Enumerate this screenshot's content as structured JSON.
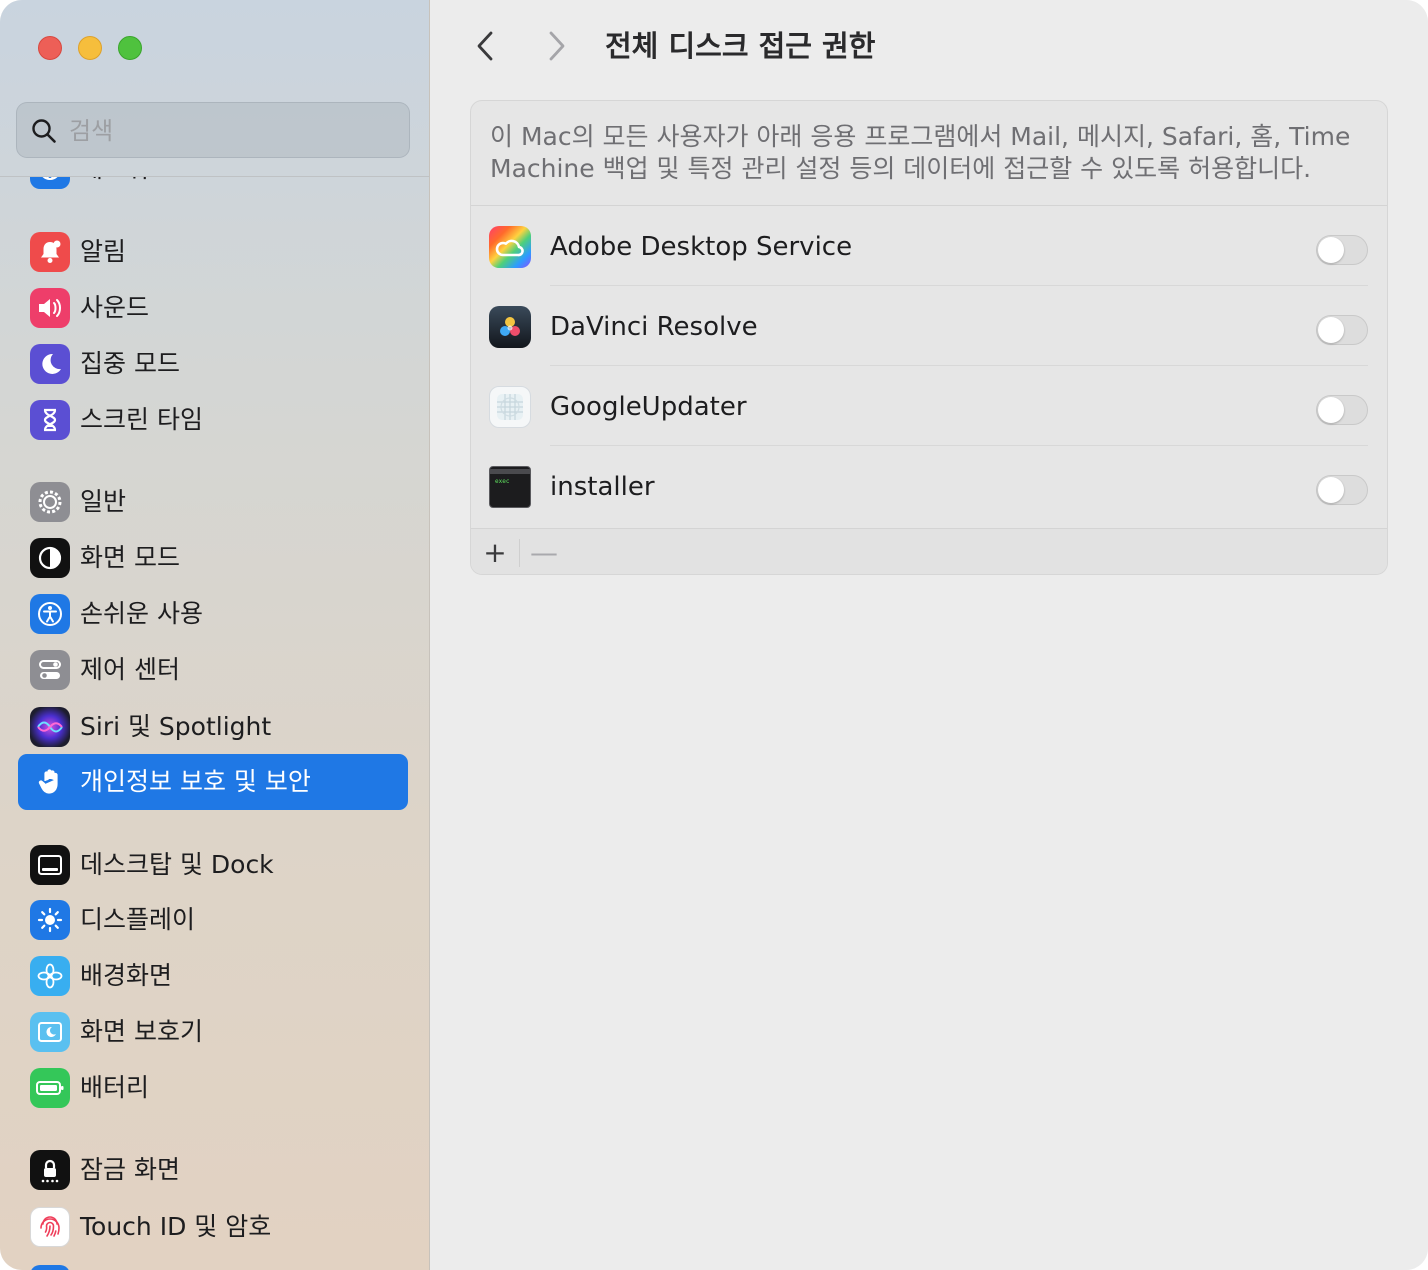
{
  "window": {
    "traffic_lights": [
      "close",
      "minimize",
      "zoom"
    ]
  },
  "search": {
    "placeholder": "검색",
    "value": ""
  },
  "sidebar": {
    "partial_top_item": {
      "label": "네트워크",
      "icon": "globe-icon",
      "color": "#1f78e5"
    },
    "groups": [
      [
        {
          "label": "알림",
          "icon": "bell-icon",
          "color": "#ef4b4b"
        },
        {
          "label": "사운드",
          "icon": "speaker-icon",
          "color": "#ee3e6a"
        },
        {
          "label": "집중 모드",
          "icon": "moon-icon",
          "color": "#5b4fd3"
        },
        {
          "label": "스크린 타임",
          "icon": "hourglass-icon",
          "color": "#5b4fd3"
        }
      ],
      [
        {
          "label": "일반",
          "icon": "gear-icon",
          "color": "#8e8e93"
        },
        {
          "label": "화면 모드",
          "icon": "appearance-icon",
          "color": "#111111"
        },
        {
          "label": "손쉬운 사용",
          "icon": "accessibility-icon",
          "color": "#1f78e5"
        },
        {
          "label": "제어 센터",
          "icon": "control-center-icon",
          "color": "#8e8e93"
        },
        {
          "label": "Siri 및 Spotlight",
          "icon": "siri-icon",
          "color": "#222233"
        },
        {
          "label": "개인정보 보호 및 보안",
          "icon": "hand-icon",
          "color": "#1f78e5",
          "selected": true
        }
      ],
      [
        {
          "label": "데스크탑 및 Dock",
          "icon": "dock-icon",
          "color": "#111111"
        },
        {
          "label": "디스플레이",
          "icon": "sun-icon",
          "color": "#1f78e5"
        },
        {
          "label": "배경화면",
          "icon": "flower-icon",
          "color": "#38aef0"
        },
        {
          "label": "화면 보호기",
          "icon": "screensaver-icon",
          "color": "#5ac0f0"
        },
        {
          "label": "배터리",
          "icon": "battery-icon",
          "color": "#34c759"
        }
      ],
      [
        {
          "label": "잠금 화면",
          "icon": "lock-icon",
          "color": "#111111"
        },
        {
          "label": "Touch ID 및 암호",
          "icon": "fingerprint-icon",
          "color": "#ffffff"
        }
      ]
    ]
  },
  "main": {
    "title": "전체 디스크 접근 권한",
    "description": "이 Mac의 모든 사용자가 아래 응용 프로그램에서 Mail, 메시지, Safari, 홈, Time Machine 백업 및 특정 관리 설정 등의 데이터에 접근할 수 있도록 허용합니다.",
    "apps": [
      {
        "name": "Adobe Desktop Service",
        "icon": "adobe-creative-cloud-icon",
        "enabled": false
      },
      {
        "name": "DaVinci Resolve",
        "icon": "davinci-resolve-icon",
        "enabled": false
      },
      {
        "name": "GoogleUpdater",
        "icon": "google-updater-icon",
        "enabled": false
      },
      {
        "name": "installer",
        "icon": "terminal-exec-icon",
        "enabled": false
      }
    ],
    "footer": {
      "add_label": "+",
      "remove_label": "—"
    }
  },
  "colors": {
    "accent": "#1f78e5",
    "close": "#ed5f57",
    "minimize": "#f6be3c",
    "zoom": "#4fc23e"
  }
}
